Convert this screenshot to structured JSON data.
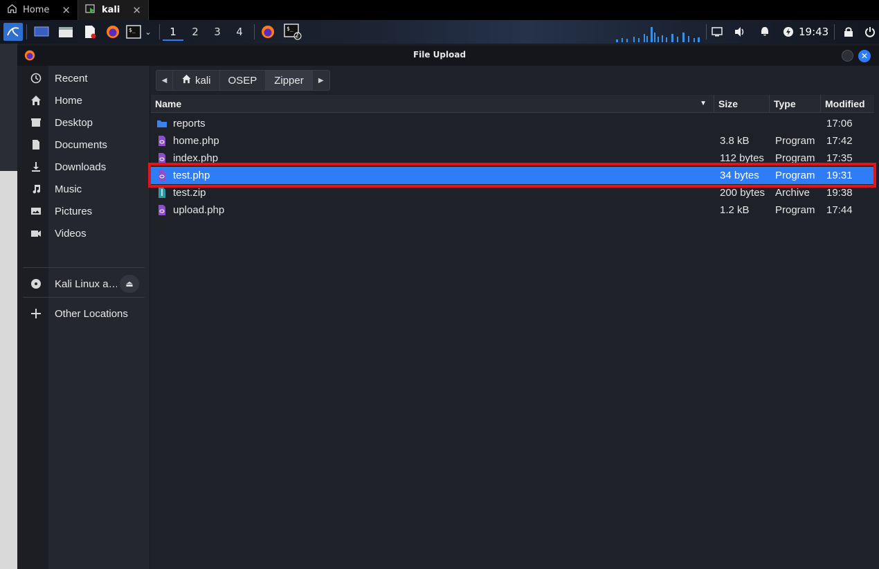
{
  "vm_tabs": [
    {
      "label": "Home",
      "icon": "home-icon"
    },
    {
      "label": "kali",
      "icon": "vm-icon"
    }
  ],
  "panel": {
    "workspaces": [
      "1",
      "2",
      "3",
      "4"
    ],
    "active_workspace": "1",
    "clock": "19:43",
    "terminal_badge": "2"
  },
  "dialog": {
    "title": "File Upload"
  },
  "sidebar": {
    "items": [
      {
        "label": "Recent",
        "icon": "clock-icon"
      },
      {
        "label": "Home",
        "icon": "home-icon"
      },
      {
        "label": "Desktop",
        "icon": "desktop-icon"
      },
      {
        "label": "Documents",
        "icon": "document-icon"
      },
      {
        "label": "Downloads",
        "icon": "download-icon"
      },
      {
        "label": "Music",
        "icon": "music-icon"
      },
      {
        "label": "Pictures",
        "icon": "picture-icon"
      },
      {
        "label": "Videos",
        "icon": "video-icon"
      }
    ],
    "device": {
      "label": "Kali Linux a…",
      "icon": "disc-icon"
    },
    "other": {
      "label": "Other Locations",
      "icon": "plus-icon"
    }
  },
  "pathbar": {
    "crumbs": [
      "kali",
      "OSEP",
      "Zipper"
    ],
    "current": "Zipper"
  },
  "columns": {
    "name": "Name",
    "size": "Size",
    "type": "Type",
    "modified": "Modified"
  },
  "files": [
    {
      "name": "reports",
      "size": "",
      "type": "",
      "modified": "17:06",
      "icon": "folder-icon",
      "selected": false
    },
    {
      "name": "home.php",
      "size": "3.8 kB",
      "type": "Program",
      "modified": "17:42",
      "icon": "php-file-icon",
      "selected": false
    },
    {
      "name": "index.php",
      "size": "112 bytes",
      "type": "Program",
      "modified": "17:35",
      "icon": "php-file-icon",
      "selected": false
    },
    {
      "name": "test.php",
      "size": "34 bytes",
      "type": "Program",
      "modified": "19:31",
      "icon": "php-file-icon",
      "selected": true
    },
    {
      "name": "test.zip",
      "size": "200 bytes",
      "type": "Archive",
      "modified": "19:38",
      "icon": "zip-file-icon",
      "selected": false
    },
    {
      "name": "upload.php",
      "size": "1.2 kB",
      "type": "Program",
      "modified": "17:44",
      "icon": "php-file-icon",
      "selected": false
    }
  ],
  "colors": {
    "accent": "#2f7df6",
    "highlight_border": "#e0141c"
  }
}
